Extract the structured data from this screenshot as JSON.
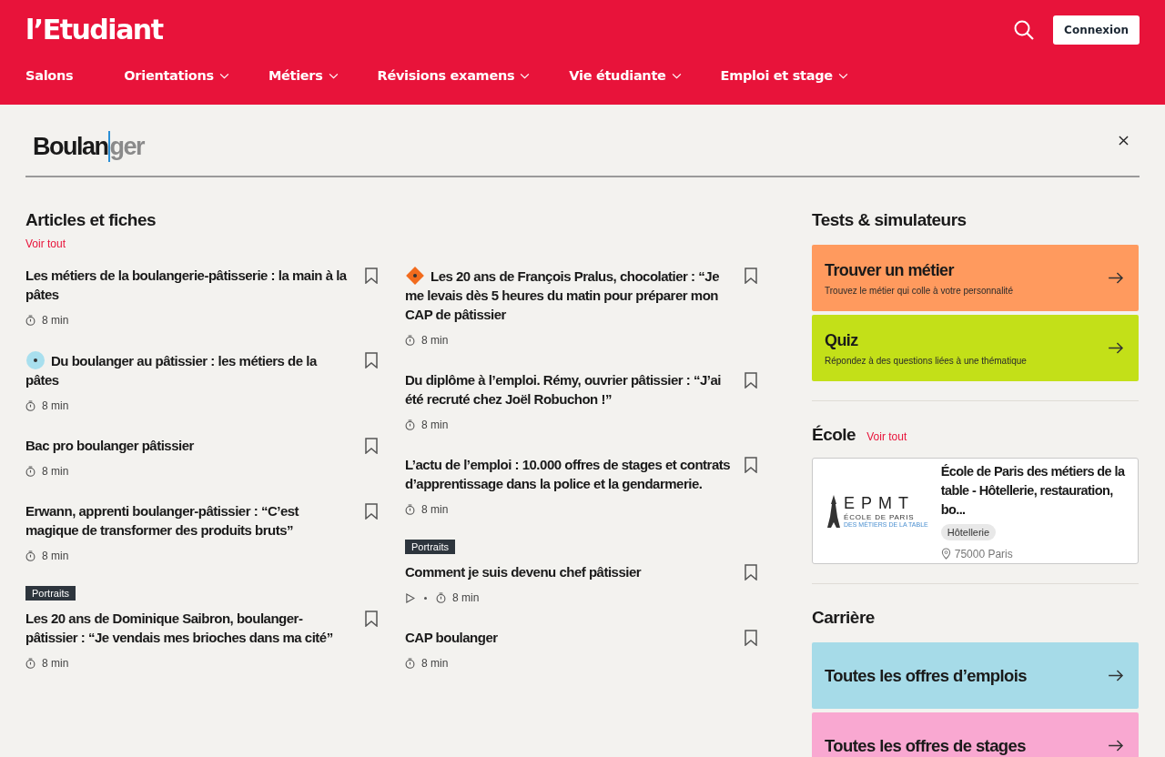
{
  "header": {
    "logo": "l’Etudiant",
    "login_button": "Connexion"
  },
  "nav": [
    {
      "label": "Salons",
      "dropdown": false
    },
    {
      "label": "Orientations",
      "dropdown": true
    },
    {
      "label": "Métiers",
      "dropdown": true
    },
    {
      "label": "Révisions examens",
      "dropdown": true
    },
    {
      "label": "Vie étudiante",
      "dropdown": true
    },
    {
      "label": "Emploi et stage",
      "dropdown": true
    }
  ],
  "search": {
    "value": "Boulan",
    "suggestion": "ger"
  },
  "articles": {
    "title": "Articles et fiches",
    "see_all": "Voir tout",
    "columns": [
      [
        {
          "title": "Les métiers de la boulangerie-pâtisserie : la main à la pâtes",
          "video": false,
          "duration": "8 min"
        },
        {
          "badge": {
            "kind": "round",
            "color": "#a8dfee"
          },
          "title": "Du boulanger au pâtissier : les métiers de la pâtes",
          "video": false,
          "duration": "8 min"
        },
        {
          "title": "Bac pro boulanger pâtissier",
          "video": false,
          "duration": "8 min"
        },
        {
          "title": "Erwann, apprenti boulanger-pâtissier : “C’est magique de transformer des produits bruts”",
          "video": false,
          "duration": "8 min"
        },
        {
          "tag": "Portraits",
          "title": "Les 20 ans de Dominique Saibron, boulanger-pâtissier : “Je vendais mes brioches dans ma cité”",
          "video": false,
          "duration": "8 min"
        }
      ],
      [
        {
          "badge": {
            "kind": "diamond",
            "color": "#f26b1d"
          },
          "title": "Les 20 ans de François Pralus, chocolatier : “Je me levais dès 5 heures du matin pour préparer mon CAP de pâtissier",
          "video": false,
          "duration": "8 min"
        },
        {
          "title": "Du diplôme à l’emploi. Rémy, ouvrier pâtissier : “J’ai été recruté chez Joël Robuchon !”",
          "video": false,
          "duration": "8 min"
        },
        {
          "title": "L’actu de l’emploi : 10.000 offres de stages et contrats d’apprentissage dans la police et la gendarmerie.",
          "video": false,
          "duration": "8 min"
        },
        {
          "tag": "Portraits",
          "title": "Comment je suis devenu chef pâtissier",
          "video": true,
          "duration": "8 min"
        },
        {
          "title": "CAP boulanger",
          "video": false,
          "duration": "8 min"
        }
      ]
    ]
  },
  "tests": {
    "title": "Tests & simulateurs",
    "cards": [
      {
        "title": "Trouver un métier",
        "subtitle": "Trouvez le métier qui colle à votre personnalité",
        "color": "#ff9a5e"
      },
      {
        "title": "Quiz",
        "subtitle": "Répondez à des questions liées à une thématique",
        "color": "#c3e018"
      }
    ]
  },
  "school": {
    "title": "École",
    "see_all": "Voir tout",
    "card": {
      "logo_mark": "EPMT",
      "logo_line_1": "ÉCOLE DE PARIS",
      "logo_line_2": "DES MÉTIERS DE LA TABLE",
      "name": "École de Paris des métiers de la table - Hôtellerie, restauration, bo...",
      "tag": "Hôtellerie",
      "location": "75000 Paris"
    }
  },
  "career": {
    "title": "Carrière",
    "cards": [
      {
        "title": "Toutes les offres d’emplois",
        "color": "#a6dbe8"
      },
      {
        "title": "Toutes les offres de stages",
        "color": "#f9a8d1"
      }
    ]
  }
}
